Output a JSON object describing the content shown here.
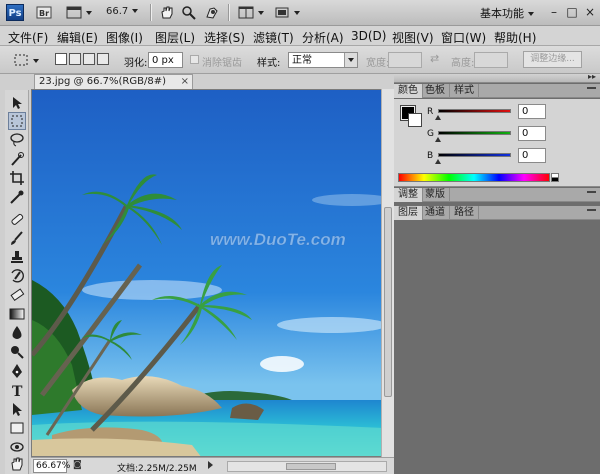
{
  "app": {
    "logo_text": "Ps",
    "zoom_level": "66.7",
    "workspace_label": "基本功能",
    "window_controls": [
      "–",
      "□",
      "×"
    ]
  },
  "menu": {
    "items": [
      "文件(F)",
      "编辑(E)",
      "图像(I)",
      "图层(L)",
      "选择(S)",
      "滤镜(T)",
      "分析(A)",
      "3D(D)",
      "视图(V)",
      "窗口(W)",
      "帮助(H)"
    ]
  },
  "options": {
    "feather_label": "羽化:",
    "feather_value": "0 px",
    "antialias_label": "消除锯齿",
    "style_label": "样式:",
    "style_value": "正常",
    "width_label": "宽度:",
    "height_label": "高度:",
    "refine_edge_label": "调整边缘..."
  },
  "document": {
    "tab_title": "23.jpg @ 66.7%(RGB/8#)",
    "tab_close": "×",
    "watermark": "www.DuoTe.com"
  },
  "status": {
    "zoom": "66.67%",
    "doc_size": "文档:2.25M/2.25M"
  },
  "panels": {
    "color_tabs": [
      "颜色",
      "色板",
      "样式"
    ],
    "channels": [
      {
        "label": "R",
        "value": "0",
        "color": "#e01010"
      },
      {
        "label": "G",
        "value": "0",
        "color": "#10b010"
      },
      {
        "label": "B",
        "value": "0",
        "color": "#1030e0"
      }
    ],
    "adjust_tabs": [
      "调整",
      "蒙版"
    ],
    "layer_tabs": [
      "图层",
      "通道",
      "路径"
    ]
  },
  "colors": {
    "foreground": "#000000",
    "background": "#ffffff",
    "sky": "#2468c9",
    "sea": "#1e9ed8"
  },
  "icons": {
    "toolbox": [
      "move-icon",
      "marquee-icon",
      "lasso-icon",
      "quick-select-icon",
      "crop-icon",
      "eyedropper-icon",
      "healing-brush-icon",
      "brush-icon",
      "clone-stamp-icon",
      "history-brush-icon",
      "eraser-icon",
      "gradient-icon",
      "blur-icon",
      "dodge-icon",
      "pen-icon",
      "type-icon",
      "path-select-icon",
      "shape-icon",
      "3d-rotate-icon",
      "3d-orbit-icon",
      "hand-icon",
      "zoom-icon"
    ]
  }
}
